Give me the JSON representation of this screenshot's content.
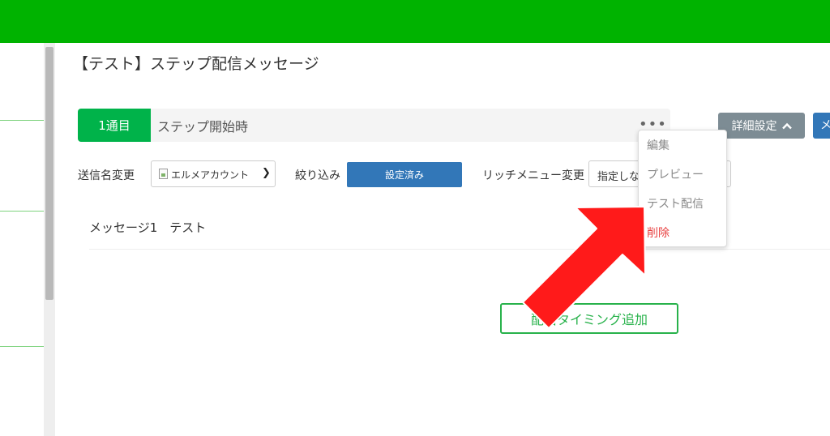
{
  "page": {
    "title": "【テスト】ステップ配信メッセージ"
  },
  "step": {
    "badge": "1通目",
    "label": "ステップ開始時",
    "more_icon": "•••"
  },
  "toolbar": {
    "detail_label": "詳細設定",
    "detail_icon": "chevron-up-icon",
    "edge_button_label": "メ"
  },
  "settings": {
    "sender_label": "送信名変更",
    "sender_value": "エルメアカウント",
    "filter_label": "絞り込み",
    "filter_button": "設定済み",
    "richmenu_label": "リッチメニュー変更",
    "richmenu_value": "指定しない"
  },
  "message": {
    "title": "メッセージ1　テスト"
  },
  "add_timing_button": "配信タイミング追加",
  "dropdown": {
    "items": [
      {
        "label": "編集"
      },
      {
        "label": "プレビュー"
      },
      {
        "label": "テスト配信"
      },
      {
        "label": "削除"
      }
    ]
  },
  "colors": {
    "topbar": "#00b300",
    "badge": "#00b34a",
    "primary": "#3277b8",
    "danger": "#e84040",
    "annotation_arrow": "#ff1a1a"
  }
}
